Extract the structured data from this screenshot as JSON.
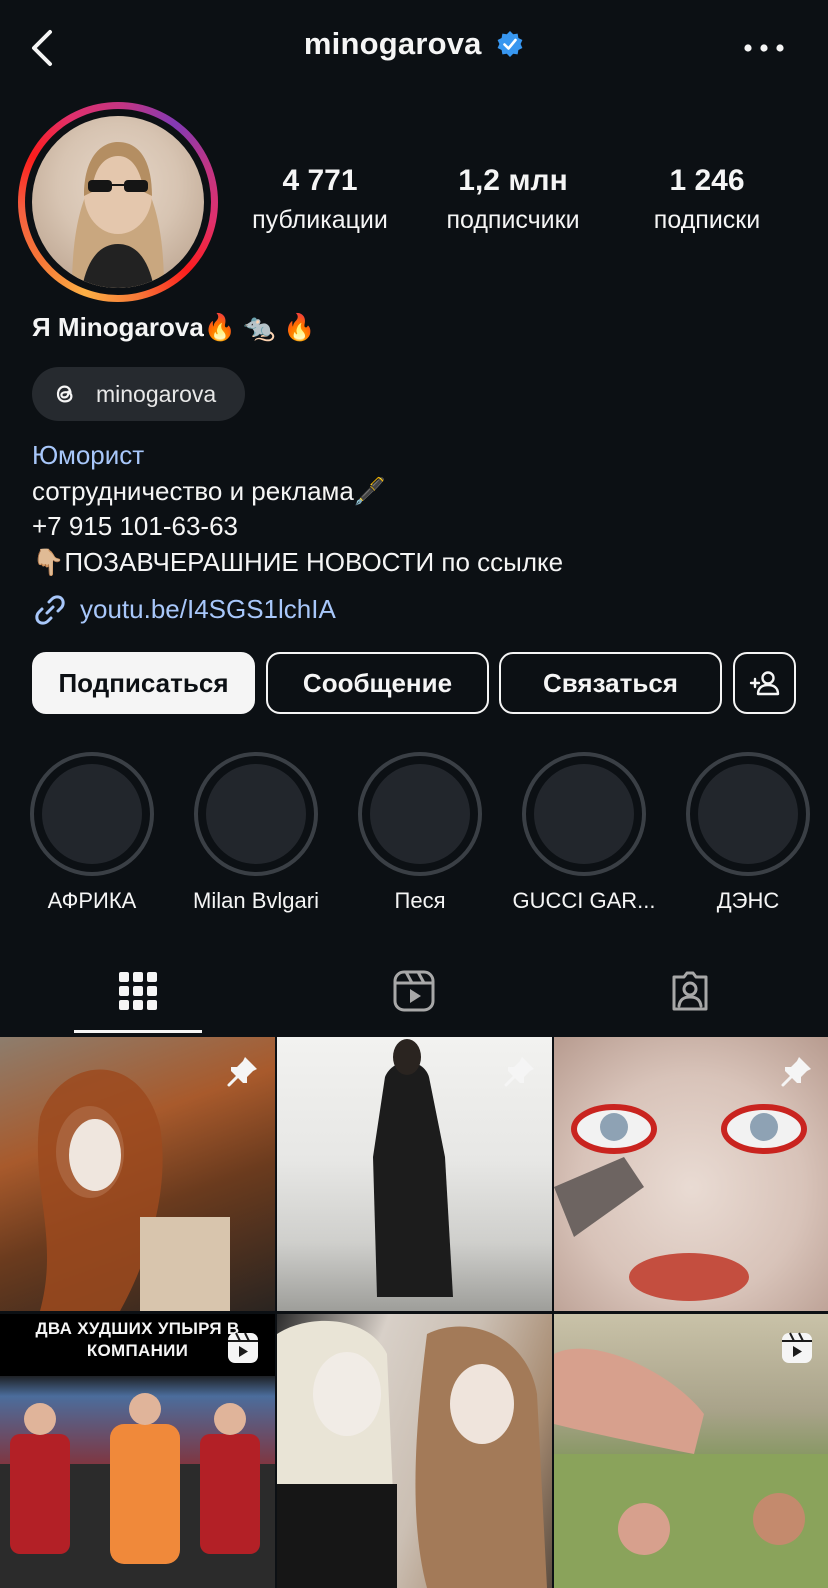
{
  "header": {
    "username": "minogarova",
    "verified": true
  },
  "stats": [
    {
      "value": "4 771",
      "label": "публикации"
    },
    {
      "value": "1,2 млн",
      "label": "подписчики"
    },
    {
      "value": "1 246",
      "label": "подписки"
    }
  ],
  "profile": {
    "display_name": "Я Minogarova🔥 🐀 🔥",
    "threads_handle": "minogarova",
    "category": "Юморист",
    "bio_lines": [
      "сотрудничество и реклама🖋️",
      "+7 915 101-63-63",
      "👇🏼ПОЗАВЧЕРАШНИЕ НОВОСТИ по ссылке"
    ],
    "link": "youtu.be/I4SGS1lchIA"
  },
  "buttons": {
    "follow": "Подписаться",
    "message": "Сообщение",
    "contact": "Связаться"
  },
  "highlights": [
    {
      "label": "АФРИКА"
    },
    {
      "label": "Milan Bvlgari"
    },
    {
      "label": "Песя"
    },
    {
      "label": "GUCCI GAR..."
    },
    {
      "label": "ДЭНС"
    }
  ],
  "tabs": [
    "grid",
    "reels",
    "tagged"
  ],
  "posts": [
    {
      "type": "pinned"
    },
    {
      "type": "pinned"
    },
    {
      "type": "pinned"
    },
    {
      "type": "reel",
      "caption": "ДВА ХУДШИХ УПЫРЯ В КОМПАНИИ"
    },
    {
      "type": "post"
    },
    {
      "type": "reel"
    }
  ],
  "colors": {
    "background": "#0c1014",
    "link": "#a8c7fa",
    "verified": "#3897f0"
  }
}
